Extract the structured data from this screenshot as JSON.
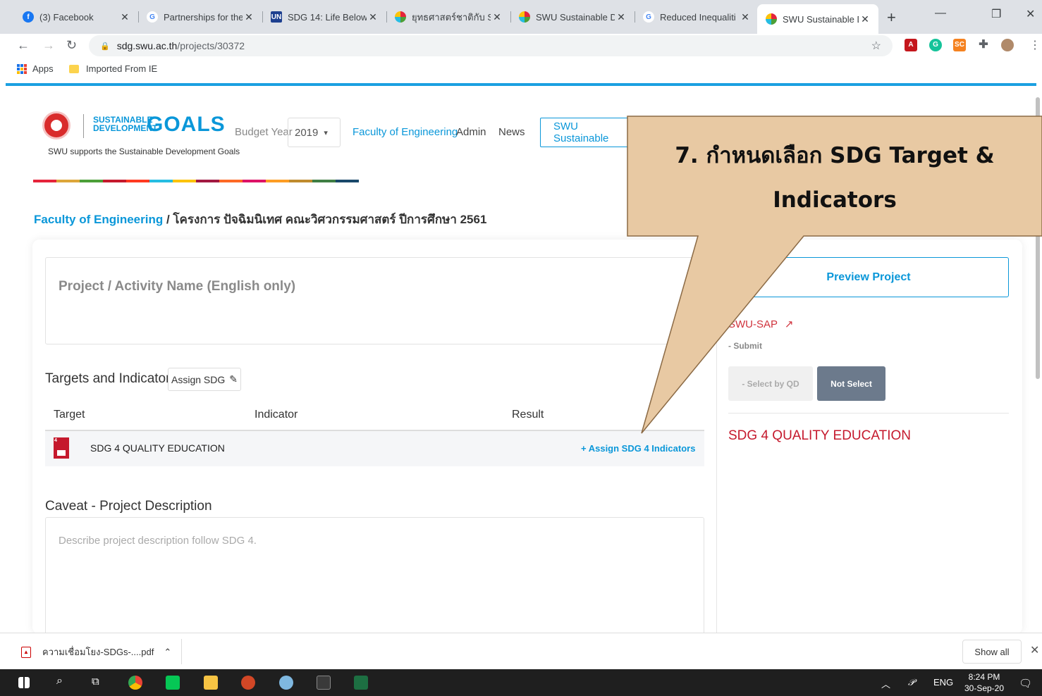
{
  "browser": {
    "tabs": [
      {
        "title": "(3) Facebook",
        "icon": "facebook-icon",
        "color": "#1877f2"
      },
      {
        "title": "Partnerships for the",
        "icon": "google-icon",
        "color": "#4285f4"
      },
      {
        "title": "SDG 14: Life Below",
        "icon": "un-icon",
        "color": "#1d3f8f"
      },
      {
        "title": "ยุทธศาสตร์ชาติกับ SI",
        "icon": "sdg-wheel-icon",
        "color": "#e5243b"
      },
      {
        "title": "SWU Sustainable D",
        "icon": "sdg-wheel-icon",
        "color": "#e5243b"
      },
      {
        "title": "Reduced Inequaliti",
        "icon": "google-icon",
        "color": "#4285f4"
      },
      {
        "title": "SWU Sustainable D",
        "icon": "sdg-wheel-icon",
        "color": "#e5243b"
      }
    ],
    "url_host": "sdg.swu.ac.th",
    "url_path": "/projects/30372",
    "bookmarks": {
      "apps": "Apps",
      "folder": "Imported From IE"
    }
  },
  "header": {
    "logo_small_1": "SUSTAINABLE",
    "logo_small_2": "DEVELOPMENT",
    "logo_big": "GOALS",
    "tagline": "SWU supports the Sustainable Development Goals",
    "budget_label": "Budget Year",
    "budget_year": "2019",
    "nav_faculty": "Faculty of Engineering",
    "nav_admin": "Admin",
    "nav_news": "News",
    "nav_sustainable": "SWU Sustainable"
  },
  "breadcrumb": {
    "link": "Faculty of Engineering",
    "separator": " / ",
    "current": "โครงการ ปัจฉิมนิเทศ คณะวิศวกรรมศาสตร์ ปีการศึกษา 2561"
  },
  "form": {
    "name_placeholder": "Project / Activity Name (English only)",
    "targets_title": "Targets and Indicators",
    "assign_sdg": "Assign SDG",
    "columns": {
      "target": "Target",
      "indicator": "Indicator",
      "result": "Result"
    },
    "sdg_row": {
      "label": "SDG 4 QUALITY EDUCATION",
      "action": "+ Assign SDG 4 Indicators",
      "color": "#c5192d"
    },
    "caveat_title": "Caveat - Project Description",
    "description_placeholder": "Describe project description follow SDG 4."
  },
  "sidebar": {
    "preview": "Preview Project",
    "sap": "SWU-SAP",
    "submit": "- Submit",
    "select_qd": "- Select by QD",
    "not_select": "Not Select",
    "sdg_heading": "SDG 4 QUALITY EDUCATION"
  },
  "callout": {
    "line1": "7. กำหนดเลือก SDG Target &",
    "line2": "Indicators"
  },
  "downloads": {
    "file": "ความเชื่อมโยง-SDGs-....pdf",
    "show_all": "Show all"
  },
  "taskbar": {
    "lang": "ENG",
    "time": "8:24 PM",
    "date": "30-Sep-20"
  },
  "colors": {
    "accent": "#0a97d9",
    "sdg4": "#c5192d",
    "callout_fill": "#e8c9a3",
    "callout_stroke": "#8b6a45"
  }
}
